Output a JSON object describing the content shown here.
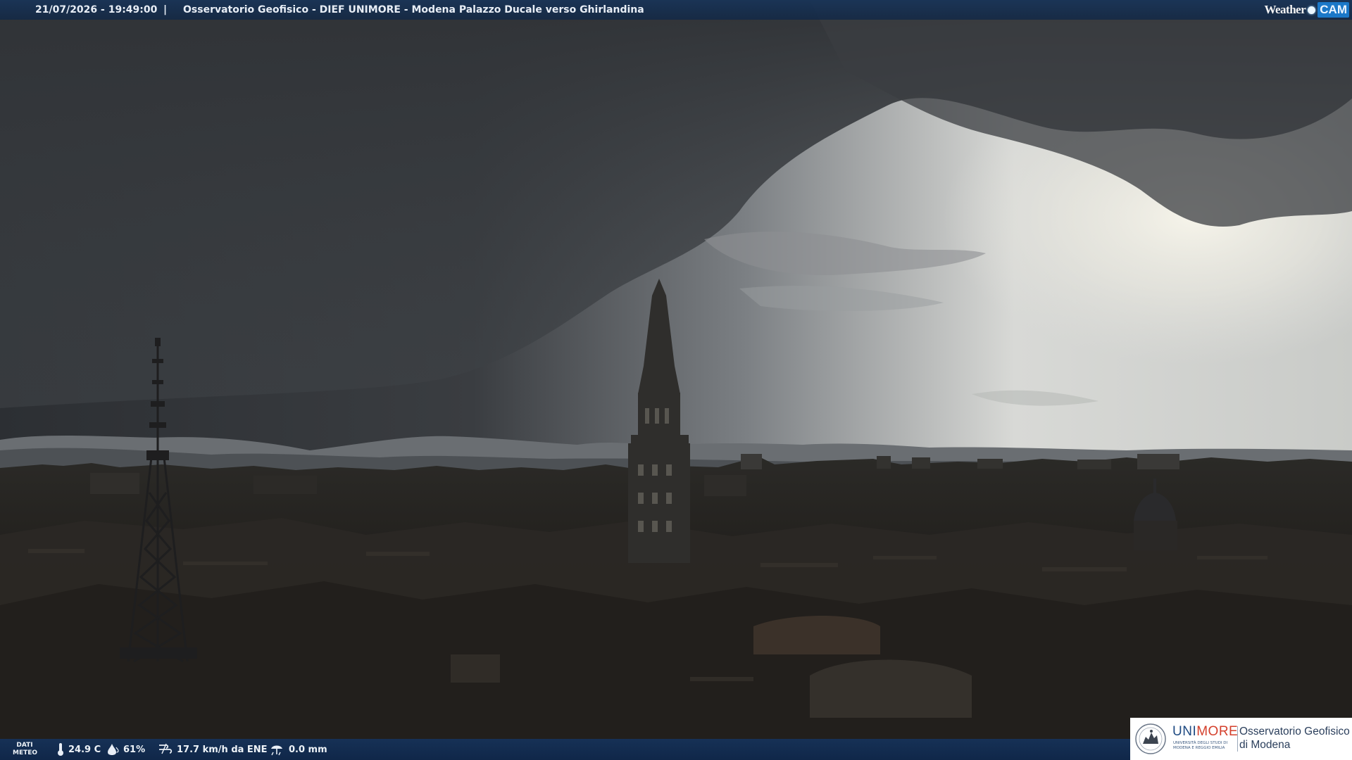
{
  "topbar": {
    "datetime": "21/07/2026 - 19:49:00",
    "separator": "|",
    "title": "Osservatorio Geofisico - DIEF UNIMORE - Modena Palazzo Ducale verso Ghirlandina",
    "brand_weather": "Weather",
    "brand_cam": "CAM"
  },
  "weather_data": {
    "label_line1": "DATI",
    "label_line2": "METEO",
    "temperature": "24.9 C",
    "humidity": "61%",
    "wind": "17.7 km/h da ENE",
    "rain": "0.0 mm",
    "icons": {
      "temperature": "thermometer-icon",
      "humidity": "humidity-drop-icon",
      "wind": "wind-icon",
      "rain": "rain-gauge-icon"
    }
  },
  "logo": {
    "uni_part1": "UNI",
    "uni_part2": "MORE",
    "uni_subtitle": "UNIVERSITÀ DEGLI STUDI DI MODENA E REGGIO EMILIA",
    "observatory_line1": "Osservatorio Geofisico",
    "observatory_line2": "di Modena"
  },
  "colors": {
    "bar_blue": "#183458",
    "brand_blue": "#1b78c8",
    "unimore_blue": "#1e4a82",
    "unimore_red": "#d4402c"
  }
}
